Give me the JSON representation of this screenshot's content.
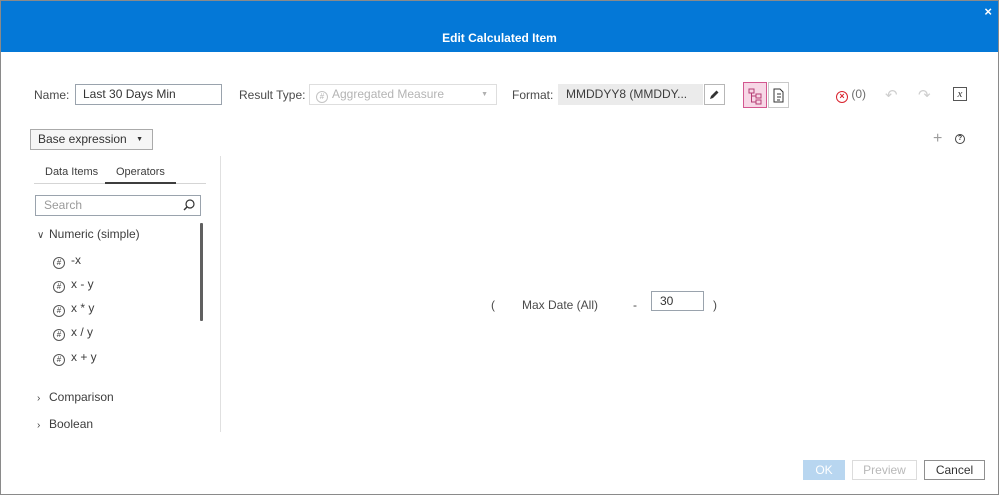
{
  "dialog": {
    "title": "Edit Calculated Item",
    "close_glyph": "×"
  },
  "toolbar": {
    "name_label": "Name:",
    "name_value": "Last 30 Days Min",
    "result_type_label": "Result Type:",
    "result_type_value": "Aggregated Measure",
    "result_type_icon": "#",
    "format_label": "Format:",
    "format_value": "MMDDYY8 (MMDDY...",
    "edit_format_icon": "pencil-icon",
    "error_count": "(0)"
  },
  "editor": {
    "base_expression": "Base expression",
    "add_icon": "+",
    "help_icon": "?"
  },
  "left_panel": {
    "tabs": [
      {
        "label": "Data Items",
        "active": false
      },
      {
        "label": "Operators",
        "active": true
      }
    ],
    "search_placeholder": "Search",
    "groups": [
      {
        "label": "Numeric (simple)",
        "expanded": true
      },
      {
        "label": "Comparison",
        "expanded": false
      },
      {
        "label": "Boolean",
        "expanded": false
      }
    ],
    "operators": [
      {
        "label": "-x"
      },
      {
        "label": "x - y"
      },
      {
        "label": "x * y"
      },
      {
        "label": "x / y"
      },
      {
        "label": "x + y"
      }
    ]
  },
  "expression": {
    "open_paren": "(",
    "item": "Max Date (All)",
    "operator": "-",
    "value": "30",
    "close_paren": ")"
  },
  "footer": {
    "ok": "OK",
    "preview": "Preview",
    "cancel": "Cancel"
  },
  "colors": {
    "titlebar": "#0478d7",
    "active_toggle_border": "#d35790",
    "active_toggle_fill": "#f7d7e6",
    "error_icon": "#d9232e",
    "ok_disabled": "#b8d6f0"
  }
}
